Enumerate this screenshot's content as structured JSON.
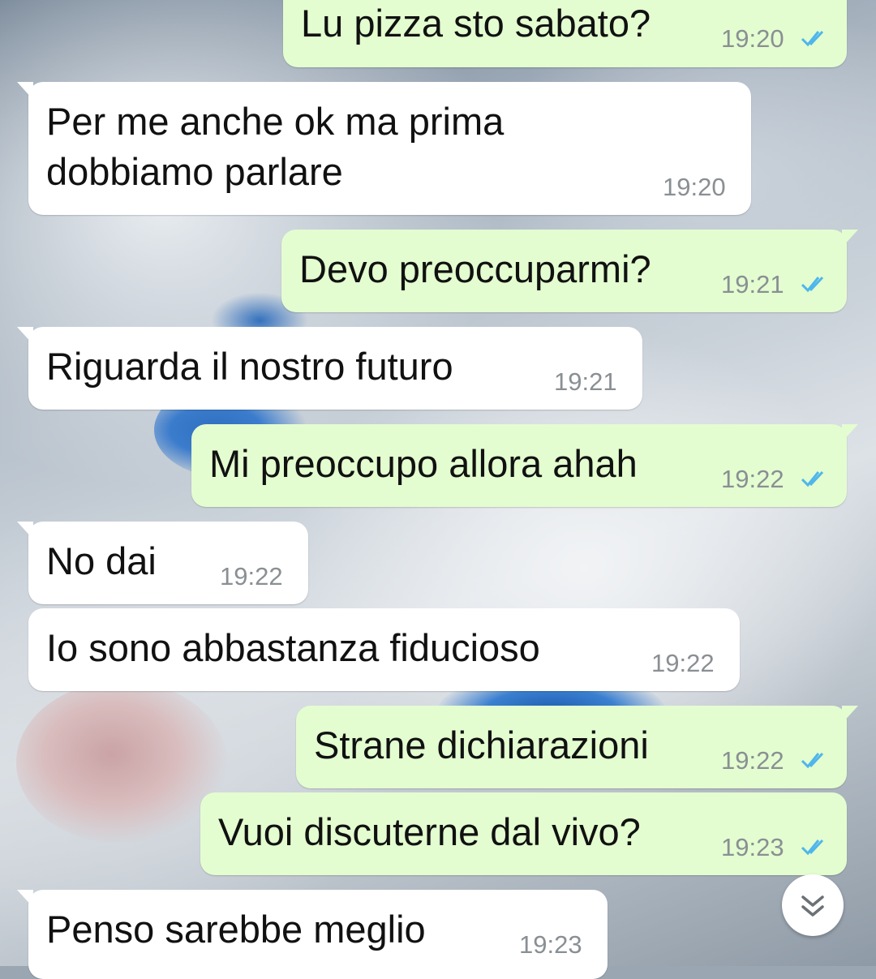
{
  "wallpaper": "white-cat-photo",
  "colors": {
    "incoming_bubble": "#ffffff",
    "outgoing_bubble": "#e3fdd0",
    "read_ticks": "#4fb6ec",
    "timestamp": "#8a8f93"
  },
  "messages": [
    {
      "direction": "out",
      "text": "Lu pizza sto sabato?",
      "time": "19:20",
      "status": "read"
    },
    {
      "direction": "in",
      "text_lines": [
        "Per me anche ok ma prima",
        "dobbiamo parlare"
      ],
      "time": "19:20"
    },
    {
      "direction": "out",
      "text": "Devo preoccuparmi?",
      "time": "19:21",
      "status": "read"
    },
    {
      "direction": "in",
      "text": "Riguarda il nostro futuro",
      "time": "19:21"
    },
    {
      "direction": "out",
      "text": "Mi preoccupo allora ahah",
      "time": "19:22",
      "status": "read"
    },
    {
      "direction": "in",
      "text": "No dai",
      "time": "19:22"
    },
    {
      "direction": "in",
      "text": "Io sono abbastanza fiducioso",
      "time": "19:22"
    },
    {
      "direction": "out",
      "text": "Strane dichiarazioni",
      "time": "19:22",
      "status": "read"
    },
    {
      "direction": "out",
      "text": "Vuoi discuterne dal vivo?",
      "time": "19:23",
      "status": "read"
    },
    {
      "direction": "in",
      "text": "Penso sarebbe meglio",
      "time": "19:23"
    }
  ],
  "scroll_button_icon": "double-chevron-down-icon"
}
